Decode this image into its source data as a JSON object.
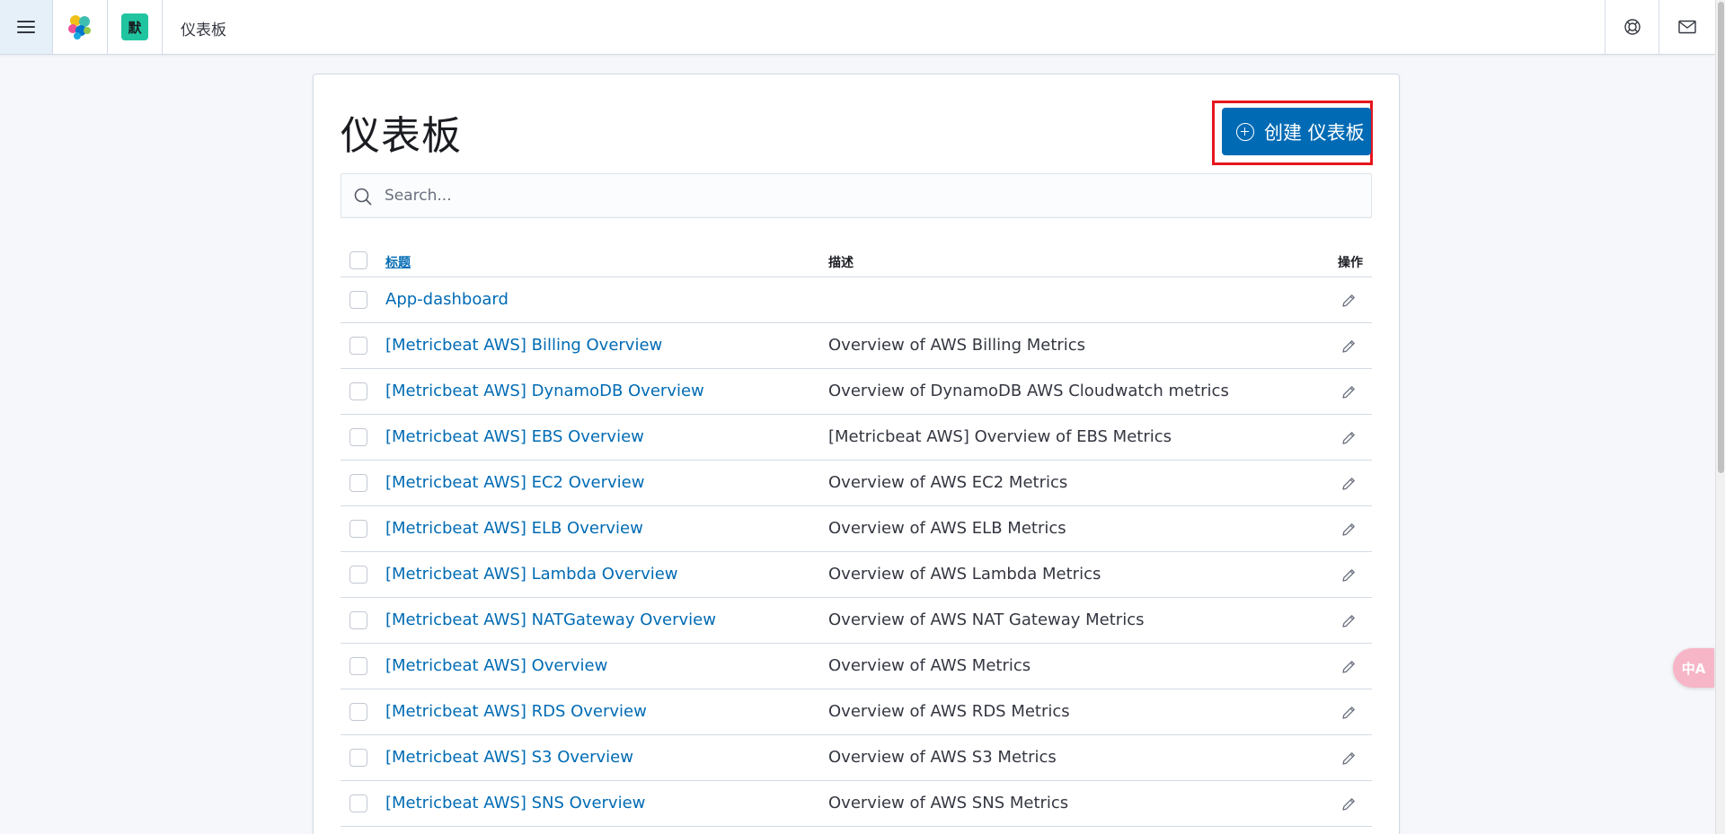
{
  "header": {
    "menu_icon": "hamburger-icon",
    "logo_icon": "elastic-logo-icon",
    "space_avatar": "默",
    "breadcrumb": "仪表板",
    "help_icon": "help-lifebuoy-icon",
    "mail_icon": "mail-icon"
  },
  "page": {
    "title": "仪表板",
    "create_button": "创建 仪表板",
    "search_placeholder": "Search..."
  },
  "table": {
    "columns": {
      "title": "标题",
      "description": "描述",
      "actions": "操作"
    },
    "rows": [
      {
        "title": "App-dashboard",
        "description": ""
      },
      {
        "title": "[Metricbeat AWS] Billing Overview",
        "description": "Overview of AWS Billing Metrics"
      },
      {
        "title": "[Metricbeat AWS] DynamoDB Overview",
        "description": "Overview of DynamoDB AWS Cloudwatch metrics"
      },
      {
        "title": "[Metricbeat AWS] EBS Overview",
        "description": "[Metricbeat AWS] Overview of EBS Metrics"
      },
      {
        "title": "[Metricbeat AWS] EC2 Overview",
        "description": "Overview of AWS EC2 Metrics"
      },
      {
        "title": "[Metricbeat AWS] ELB Overview",
        "description": "Overview of AWS ELB Metrics"
      },
      {
        "title": "[Metricbeat AWS] Lambda Overview",
        "description": "Overview of AWS Lambda Metrics"
      },
      {
        "title": "[Metricbeat AWS] NATGateway Overview",
        "description": "Overview of AWS NAT Gateway Metrics"
      },
      {
        "title": "[Metricbeat AWS] Overview",
        "description": "Overview of AWS Metrics"
      },
      {
        "title": "[Metricbeat AWS] RDS Overview",
        "description": "Overview of AWS RDS Metrics"
      },
      {
        "title": "[Metricbeat AWS] S3 Overview",
        "description": "Overview of AWS S3 Metrics"
      },
      {
        "title": "[Metricbeat AWS] SNS Overview",
        "description": "Overview of AWS SNS Metrics"
      }
    ]
  },
  "floating": {
    "translate_label": "中A",
    "icon": "translate-icon"
  },
  "colors": {
    "accent": "#006bb4",
    "highlight_outline": "#e7161d",
    "space_avatar": "#20c5a0"
  }
}
